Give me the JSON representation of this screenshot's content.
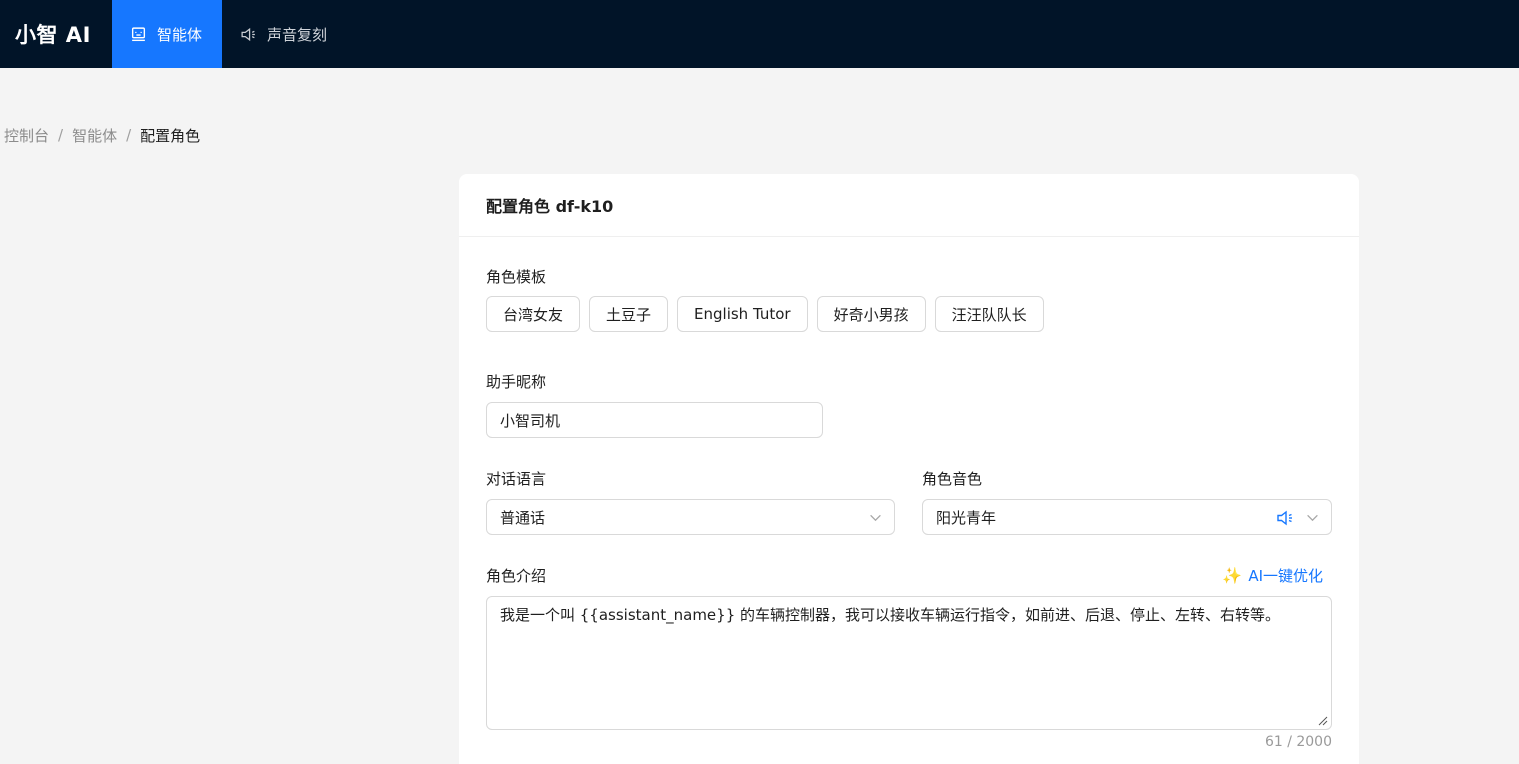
{
  "app": {
    "logo": "小智 AI"
  },
  "nav": {
    "items": [
      {
        "label": "智能体",
        "icon": "robot-icon",
        "active": true
      },
      {
        "label": "声音复刻",
        "icon": "speaker-icon",
        "active": false
      }
    ]
  },
  "breadcrumb": [
    "控制台",
    "智能体",
    "配置角色"
  ],
  "card": {
    "title": "配置角色 df-k10",
    "template": {
      "label": "角色模板",
      "options": [
        "台湾女友",
        "土豆子",
        "English Tutor",
        "好奇小男孩",
        "汪汪队队长"
      ]
    },
    "nickname": {
      "label": "助手昵称",
      "value": "小智司机"
    },
    "language": {
      "label": "对话语言",
      "value": "普通话"
    },
    "voice": {
      "label": "角色音色",
      "value": "阳光青年"
    },
    "intro": {
      "label": "角色介绍",
      "ai_optimize": "AI一键优化",
      "value": "我是一个叫 {{assistant_name}} 的车辆控制器，我可以接收车辆运行指令，如前进、后退、停止、左转、右转等。",
      "counter": "61 / 2000"
    }
  },
  "colors": {
    "topbar": "#011428",
    "accent": "#1677ff",
    "background": "#f4f4f4"
  }
}
